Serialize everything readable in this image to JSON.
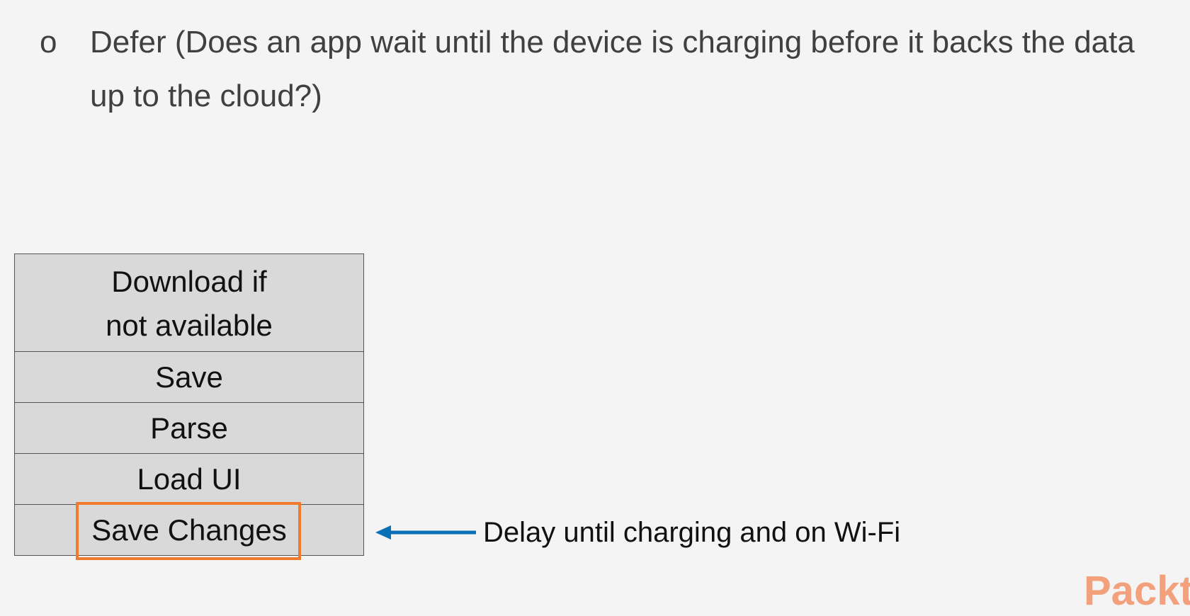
{
  "slide": {
    "bullet_marker": "o",
    "bullet_text": "Defer (Does an app wait until the device is charging before it backs the data up to the cloud?)"
  },
  "stack": {
    "items": [
      "Download if not available",
      "Save",
      "Parse",
      "Load UI",
      "Save Changes"
    ],
    "highlighted_index": 4
  },
  "annotation": {
    "text": "Delay until charging and on Wi-Fi",
    "arrow_color": "#0b6fb7",
    "highlight_color": "#f07a2e"
  },
  "brand": {
    "logo_text": "Packt"
  }
}
